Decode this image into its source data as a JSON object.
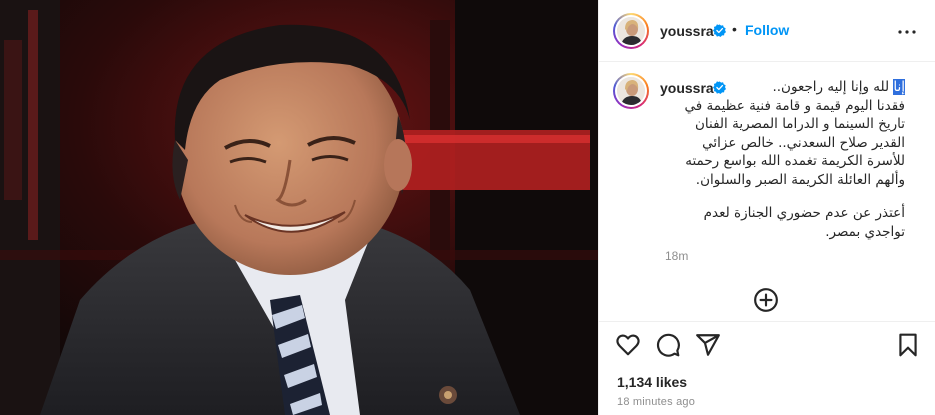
{
  "post": {
    "username": "youssra",
    "verified": true,
    "follow_label": "Follow",
    "separator": "•",
    "caption": {
      "highlight": "إنا",
      "line1_rest": " لله وإنا إليه راجعون..",
      "lines": [
        "فقدنا اليوم قيمة و قامة فنية عظيمة في",
        "تاريخ السينما و الدراما المصرية الفنان",
        "القدير صلاح السعدني.. خالص عزائي",
        "للأسرة الكريمة تغمده الله بواسع رحمته",
        "وألهم العائلة الكريمة الصبر والسلوان."
      ],
      "lines2": [
        "أعتذر عن عدم حضوري الجنازة لعدم",
        "تواجدي بمصر."
      ]
    },
    "caption_time": "18m",
    "likes": "1,134 likes",
    "time_ago": "18 minutes ago"
  },
  "icons": {
    "verified": "verified-badge-icon",
    "more": "more-options-icon",
    "add_comment": "add-circle-icon",
    "like": "heart-icon",
    "comment": "comment-bubble-icon",
    "share": "paper-plane-icon",
    "save": "bookmark-icon"
  },
  "colors": {
    "accent": "#0095f6",
    "text": "#262626",
    "muted": "#8e8e8e",
    "verified": "#0095f6"
  }
}
